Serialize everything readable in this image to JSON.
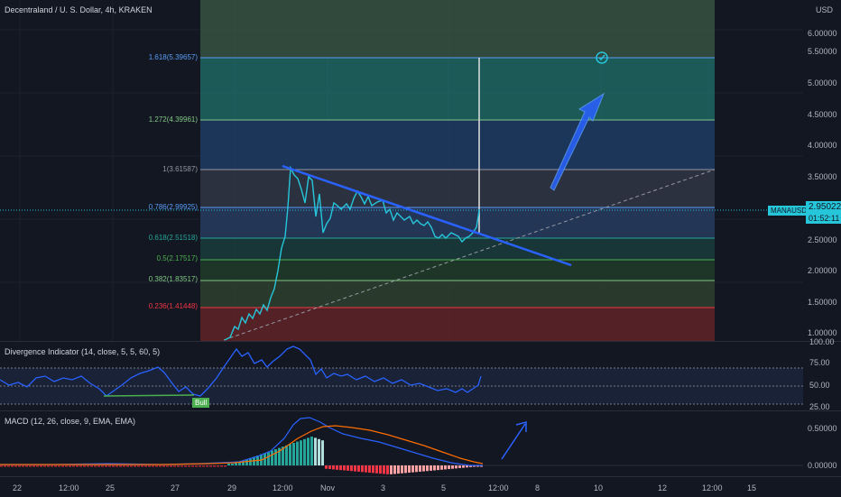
{
  "symbol_title": "Decentraland / U. S. Dollar, 4h, KRAKEN",
  "currency": "USD",
  "price_axis": [
    "6.00000",
    "5.50000",
    "5.00000",
    "4.50000",
    "4.00000",
    "3.50000",
    "3.00000",
    "2.50000",
    "2.00000",
    "1.50000",
    "1.00000"
  ],
  "ticker_tag": "MANAUSD",
  "price_tag": "2.95022",
  "countdown": "01:52:11",
  "fib_levels": [
    {
      "label": "1.618(5.39657)",
      "color": "#5b9cf6",
      "value": 5.39657
    },
    {
      "label": "1.272(4.39961)",
      "color": "#81c784",
      "value": 4.39961
    },
    {
      "label": "1(3.61587)",
      "color": "#9598a1",
      "value": 3.61587
    },
    {
      "label": "0.786(2.99925)",
      "color": "#5b9cf6",
      "value": 2.99925
    },
    {
      "label": "0.618(2.51518)",
      "color": "#26a69a",
      "value": 2.51518
    },
    {
      "label": "0.5(2.17517)",
      "color": "#4caf50",
      "value": 2.17517
    },
    {
      "label": "0.382(1.83517)",
      "color": "#81c784",
      "value": 1.83517
    },
    {
      "label": "0.236(1.41448)",
      "color": "#f23645",
      "value": 1.41448
    }
  ],
  "div_indicator": {
    "title": "Divergence Indicator (14, close, 5, 5, 60, 5)",
    "axis": [
      "100.00",
      "75.00",
      "50.00",
      "25.00"
    ],
    "bull_label": "Bull"
  },
  "macd": {
    "title": "MACD (12, 26, close, 9, EMA, EMA)",
    "axis": [
      "0.50000",
      "0.00000"
    ]
  },
  "time_axis": [
    "22",
    "12:00",
    "25",
    "27",
    "29",
    "12:00",
    "Nov",
    "3",
    "5",
    "12:00",
    "8",
    "10",
    "12",
    "12:00",
    "15"
  ],
  "colors": {
    "price": "#26c6da",
    "trendline": "#2962ff",
    "rsi": "#2962ff",
    "macd_line": "#2962ff",
    "signal_line": "#ff6d00"
  },
  "chart_data": {
    "type": "line",
    "title": "Decentraland / U. S. Dollar, 4h, KRAKEN",
    "ylabel": "USD",
    "ylim": [
      0.95,
      6.3
    ],
    "last_value": 2.95022,
    "close_approx": [
      1.0,
      1.1,
      1.3,
      1.35,
      1.5,
      1.45,
      1.6,
      1.65,
      1.8,
      2.0,
      2.7,
      3.6,
      3.5,
      3.4,
      3.1,
      2.85,
      3.3,
      2.9,
      3.0,
      3.1,
      3.2,
      3.05,
      3.1,
      2.95,
      3.0,
      2.85,
      2.75,
      2.8,
      2.7,
      2.6,
      2.5,
      2.55,
      2.45,
      2.55,
      2.6,
      2.95
    ]
  }
}
